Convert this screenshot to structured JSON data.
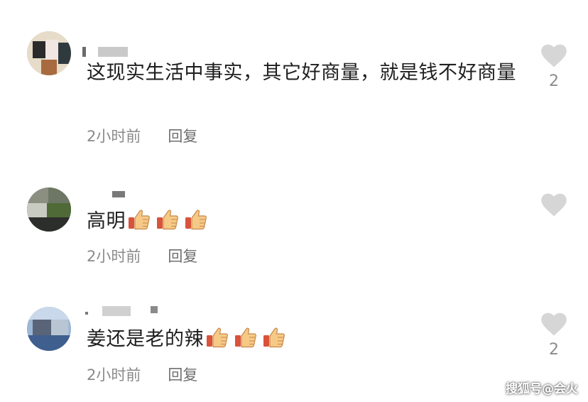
{
  "comments": [
    {
      "text": "这现实生活中事实，其它好商量，就是钱不好商量",
      "time": "2小时前",
      "reply": "回复",
      "likes": "2",
      "thumbs": 0
    },
    {
      "text": "高明",
      "time": "2小时前",
      "reply": "回复",
      "likes": "",
      "thumbs": 3
    },
    {
      "text": "姜还是老的辣",
      "time": "2小时前",
      "reply": "回复",
      "likes": "2",
      "thumbs": 3
    }
  ],
  "icons": {
    "like": "heart-icon",
    "emoji": "thumbs-up-emoji"
  },
  "colors": {
    "heart": "#d6d6d6",
    "meta_text": "#8a8a8a"
  },
  "watermark": "搜狐号@会火"
}
